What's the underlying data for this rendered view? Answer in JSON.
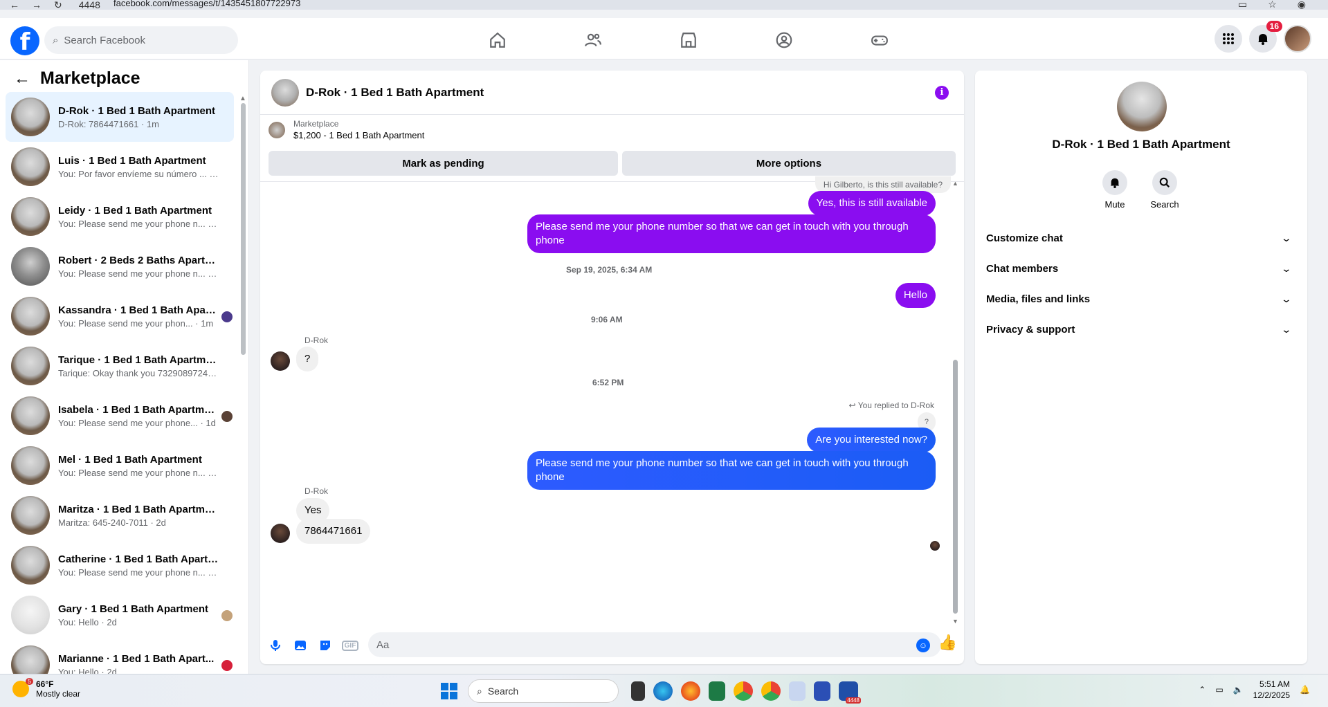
{
  "browser": {
    "tab_count": "4448",
    "url": "facebook.com/messages/t/1435451807722973"
  },
  "header": {
    "search_placeholder": "Search Facebook",
    "notification_count": "16"
  },
  "sidebar": {
    "title": "Marketplace",
    "conversations": [
      {
        "name": "D-Rok · 1 Bed 1 Bath Apartment",
        "preview": "D-Rok: 7864471661 · 1m"
      },
      {
        "name": "Luis · 1 Bed 1 Bath Apartment",
        "preview": "You: Por favor envíeme su número ... · 1m"
      },
      {
        "name": "Leidy · 1 Bed 1 Bath Apartment",
        "preview": "You: Please send me your phone n... · 1m"
      },
      {
        "name": "Robert · 2 Beds 2 Baths Apartme...",
        "preview": "You: Please send me your phone n... · 1m"
      },
      {
        "name": "Kassandra · 1 Bed 1 Bath Apart...",
        "preview": "You: Please send me your phon... · 1m"
      },
      {
        "name": "Tarique · 1 Bed 1 Bath Apartment",
        "preview": "Tarique: Okay thank you 7329089724 · 1d"
      },
      {
        "name": "Isabela · 1 Bed 1 Bath Apartme...",
        "preview": "You: Please send me your phone... · 1d"
      },
      {
        "name": "Mel · 1 Bed 1 Bath Apartment",
        "preview": "You: Please send me your phone n... · 1d"
      },
      {
        "name": "Maritza · 1 Bed 1 Bath Apartment",
        "preview": "Maritza: 645-240-7011 · 2d"
      },
      {
        "name": "Catherine · 1 Bed 1 Bath Apartm...",
        "preview": "You: Please send me your phone n... · 2d"
      },
      {
        "name": "Gary · 1 Bed 1 Bath Apartment",
        "preview": "You: Hello · 2d"
      },
      {
        "name": "Marianne · 1 Bed 1 Bath Apart...",
        "preview": "You: Hello · 2d"
      }
    ]
  },
  "chat": {
    "title": "D-Rok · 1 Bed 1 Bath Apartment",
    "marketplace_label": "Marketplace",
    "listing": "$1,200 - 1 Bed 1 Bath Apartment",
    "mark_pending": "Mark as pending",
    "more_options": "More options",
    "messages": {
      "m0": "Hi Gilberto, is this still available?",
      "m1": "Yes, this is still available",
      "m2": "Please send me your phone  number so that we can get in touch with you through phone",
      "ts1": "Sep 19, 2025, 6:34 AM",
      "m3": "Hello",
      "ts2": "9:06 AM",
      "sender1": "D-Rok",
      "m4": "?",
      "ts3": "6:52 PM",
      "replied": "You replied to D-Rok",
      "quoted": "?",
      "m5": "Are you interested now?",
      "m6": "Please send me your phone  number so that we can get in touch with you through phone",
      "sender2": "D-Rok",
      "m7": "Yes",
      "m8": "7864471661"
    },
    "composer_placeholder": "Aa",
    "gif_label": "GIF"
  },
  "info_panel": {
    "title": "D-Rok · 1 Bed 1 Bath Apartment",
    "mute": "Mute",
    "search": "Search",
    "sections": [
      "Customize chat",
      "Chat members",
      "Media, files and links",
      "Privacy & support"
    ]
  },
  "taskbar": {
    "weather_badge": "5",
    "temperature": "66°F",
    "condition": "Mostly clear",
    "search": "Search",
    "time": "5:51 AM",
    "date": "12/2/2025",
    "app_badge": "4448"
  },
  "colors": {
    "accent_purple": "#8a0df0",
    "accent_blue": "#0866ff"
  }
}
